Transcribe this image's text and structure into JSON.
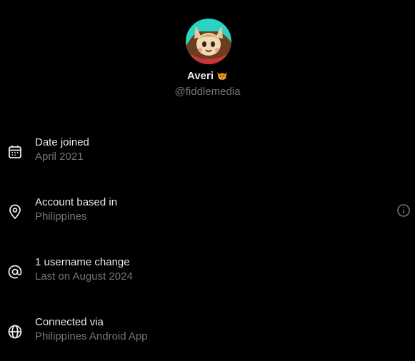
{
  "profile": {
    "display_name": "Averi",
    "name_emoji": "fox-face-emoji",
    "handle": "@fiddlemedia",
    "avatar": "cartoon-fox-character-avatar"
  },
  "rows": [
    {
      "icon": "calendar-icon",
      "title": "Date joined",
      "subtitle": "April 2021"
    },
    {
      "icon": "location-pin-icon",
      "title": "Account based in",
      "subtitle": "Philippines",
      "action_icon": "info-icon"
    },
    {
      "icon": "at-sign-icon",
      "title": "1 username change",
      "subtitle": "Last on August 2024"
    },
    {
      "icon": "globe-icon",
      "title": "Connected via",
      "subtitle": "Philippines Android App"
    }
  ],
  "colors": {
    "background": "#000000",
    "primary_text": "#e7e9ea",
    "secondary_text": "#71767b",
    "avatar_ring": "#2ad3c4"
  }
}
